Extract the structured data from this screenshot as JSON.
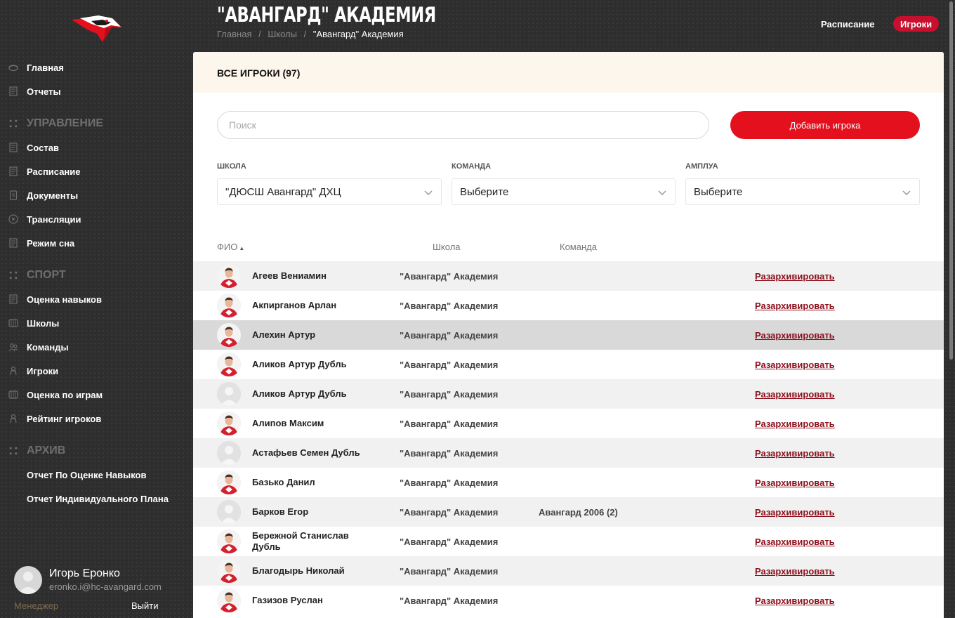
{
  "sidebar": {
    "items_top": [
      {
        "label": "Главная",
        "icon": "puck-icon"
      },
      {
        "label": "Отчеты",
        "icon": "document-icon"
      }
    ],
    "sections": [
      {
        "title": "УПРАВЛЕНИЕ",
        "items": [
          {
            "label": "Состав",
            "icon": "document-icon"
          },
          {
            "label": "Расписание",
            "icon": "document-icon"
          },
          {
            "label": "Документы",
            "icon": "file-icon"
          },
          {
            "label": "Трансляции",
            "icon": "play-icon"
          },
          {
            "label": "Режим сна",
            "icon": "document-icon"
          }
        ]
      },
      {
        "title": "СПОРТ",
        "items": [
          {
            "label": "Оценка навыков",
            "icon": "document-icon"
          },
          {
            "label": "Школы",
            "icon": "rink-icon"
          },
          {
            "label": "Команды",
            "icon": "team-icon"
          },
          {
            "label": "Игроки",
            "icon": "player-icon"
          },
          {
            "label": "Оценка по играм",
            "icon": "rink-icon"
          },
          {
            "label": "Рейтинг игроков",
            "icon": "player-icon"
          }
        ]
      },
      {
        "title": "АРХИВ",
        "items": [
          {
            "label": "Отчет По Оценке Навыков"
          },
          {
            "label": "Отчет Индивидуального Плана"
          }
        ]
      }
    ]
  },
  "user": {
    "name": "Игорь Еронко",
    "email": "eronko.i@hc-avangard.com",
    "role": "Менеджер",
    "logout": "Выйти"
  },
  "header": {
    "title": "\"АВАНГАРД\" АКАДЕМИЯ",
    "breadcrumb": [
      "Главная",
      "/",
      "Школы",
      "/",
      "\"Авангард\" Академия"
    ],
    "links": {
      "schedule": "Расписание",
      "players": "Игроки"
    }
  },
  "panel": {
    "title": "ВСЕ ИГРОКИ (97)",
    "search_placeholder": "Поиск",
    "add_button": "Добавить игрока",
    "filters": {
      "school": {
        "label": "ШКОЛА",
        "value": "\"ДЮСШ Авангард\" ДХЦ"
      },
      "team": {
        "label": "КОМАНДА",
        "value": "Выберите"
      },
      "role": {
        "label": "АМПЛУА",
        "value": "Выберите"
      }
    },
    "columns": {
      "name": "ФИО",
      "sort_arrow": "▲",
      "school": "Школа",
      "team": "Команда"
    },
    "unarchive_label": "Разархивировать",
    "rows": [
      {
        "name": "Агеев Вениамин",
        "school": "\"Авангард\" Академия",
        "team": "",
        "photo": true
      },
      {
        "name": "Акпирганов Арлан",
        "school": "\"Авангард\" Академия",
        "team": "",
        "photo": true
      },
      {
        "name": "Алехин Артур",
        "school": "\"Авангард\" Академия",
        "team": "",
        "photo": true
      },
      {
        "name": "Аликов Артур Дубль",
        "school": "\"Авангард\" Академия",
        "team": "",
        "photo": true
      },
      {
        "name": "Аликов Артур Дубль",
        "school": "\"Авангард\" Академия",
        "team": "",
        "photo": false
      },
      {
        "name": "Алипов Максим",
        "school": "\"Авангард\" Академия",
        "team": "",
        "photo": true
      },
      {
        "name": "Астафьев Семен Дубль",
        "school": "\"Авангард\" Академия",
        "team": "",
        "photo": false
      },
      {
        "name": "Базько Данил",
        "school": "\"Авангард\" Академия",
        "team": "",
        "photo": true
      },
      {
        "name": "Барков Егор",
        "school": "\"Авангард\" Академия",
        "team": "Авангард 2006 (2)",
        "photo": false
      },
      {
        "name": "Бережной Станислав Дубль",
        "school": "\"Авангард\" Академия",
        "team": "",
        "photo": true
      },
      {
        "name": "Благодырь Николай",
        "school": "\"Авангард\" Академия",
        "team": "",
        "photo": true
      },
      {
        "name": "Газизов Руслан",
        "school": "\"Авангард\" Академия",
        "team": "",
        "photo": true
      }
    ]
  },
  "colors": {
    "accent": "#e4101e",
    "dark_accent": "#8b0f1c",
    "sidebar_bg": "#2e2e2e"
  }
}
